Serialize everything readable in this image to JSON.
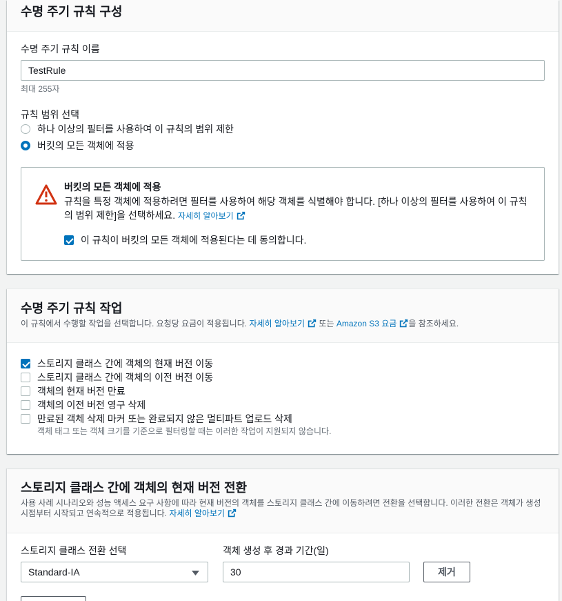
{
  "colors": {
    "accent": "#0073bb",
    "warning": "#d13212",
    "text": "#16191f",
    "secondary_text": "#687078",
    "page_background": "#f2f3f3"
  },
  "icons": {
    "warning": "warning-icon",
    "external_link": "external-link-icon",
    "dropdown": "caret-down-icon"
  },
  "config_panel": {
    "title": "수명 주기 규칙 구성",
    "rule_name_label": "수명 주기 규칙 이름",
    "rule_name_value": "TestRule",
    "rule_name_hint": "최대 255자",
    "scope_label": "규칙 범위 선택",
    "scope_options": [
      {
        "label": "하나 이상의 필터를 사용하여 이 규칙의 범위 제한",
        "selected": false
      },
      {
        "label": "버킷의 모든 객체에 적용",
        "selected": true
      }
    ],
    "warning": {
      "title": "버킷의 모든 객체에 적용",
      "body": "규칙을 특정 객체에 적용하려면 필터를 사용하여 해당 객체를 식별해야 합니다. [하나 이상의 필터를 사용하여 이 규칙의 범위 제한]을 선택하세요.",
      "learn_more": "자세히 알아보기",
      "acknowledge_label": "이 규칙이 버킷의 모든 객체에 적용된다는 데 동의합니다.",
      "acknowledge_checked": true
    }
  },
  "actions_panel": {
    "title": "수명 주기 규칙 작업",
    "description": "이 규칙에서 수행할 작업을 선택합니다. 요청당 요금이 적용됩니다.",
    "learn_more": "자세히 알아보기",
    "or_text": "또는",
    "pricing_link": "Amazon S3 요금",
    "description_suffix": "을 참조하세요.",
    "actions": [
      {
        "label": "스토리지 클래스 간에 객체의 현재 버전 이동",
        "checked": true
      },
      {
        "label": "스토리지 클래스 간에 객체의 이전 버전 이동",
        "checked": false
      },
      {
        "label": "객체의 현재 버전 만료",
        "checked": false
      },
      {
        "label": "객체의 이전 버전 영구 삭제",
        "checked": false
      },
      {
        "label": "만료된 객체 삭제 마커 또는 완료되지 않은 멀티파트 업로드 삭제",
        "checked": false
      }
    ],
    "note": "객체 태그 또는 객체 크기를 기준으로 필터링할 때는 이러한 작업이 지원되지 않습니다."
  },
  "transition_panel": {
    "title": "스토리지 클래스 간에 객체의 현재 버전 전환",
    "description": "사용 사례 시나리오와 성능 액세스 요구 사항에 따라 현재 버전의 객체를 스토리지 클래스 간에 이동하려면 전환을 선택합니다. 이러한 전환은 객체가 생성 시점부터 시작되고 연속적으로 적용됩니다.",
    "learn_more": "자세히 알아보기",
    "storage_class_label": "스토리지 클래스 전환 선택",
    "storage_class_value": "Standard-IA",
    "days_label": "객체 생성 후 경과 기간(일)",
    "days_value": "30",
    "remove_button": "제거"
  }
}
